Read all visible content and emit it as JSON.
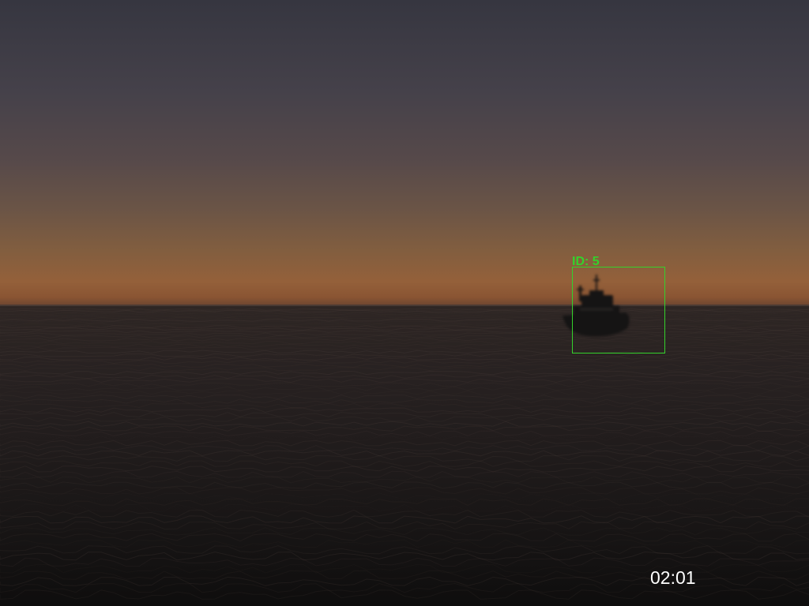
{
  "scene": {
    "description_free": true,
    "colors": {
      "sky_top": "#363640",
      "horizon_glow": "#94603a",
      "sea": "#1e1a1a",
      "detection_box": "#34d12c",
      "timestamp_text": "#ffffff"
    }
  },
  "detections": [
    {
      "label": "ID: 5"
    }
  ],
  "overlay": {
    "timestamp": "02:01"
  }
}
